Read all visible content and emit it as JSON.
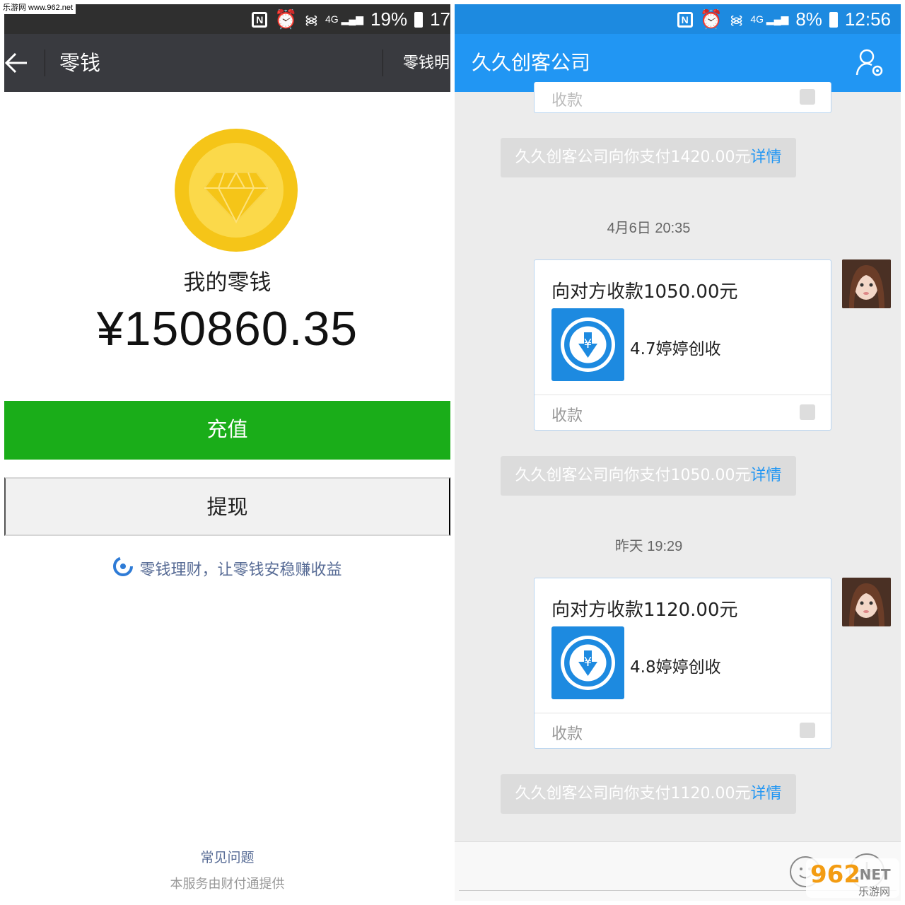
{
  "watermark": {
    "site": "乐游网 www.962.net",
    "logo_main": "962",
    "logo_tld": ".NET",
    "logo_sub": "乐游网"
  },
  "left": {
    "status": {
      "battery": "19%",
      "time": "17"
    },
    "nav": {
      "title": "零钱",
      "right_link": "零钱明"
    },
    "label": "我的零钱",
    "balance": "¥150860.35",
    "recharge_label": "充值",
    "withdraw_label": "提现",
    "finance_link": "零钱理财，让零钱安稳赚收益",
    "faq": "常见问题",
    "provider": "本服务由财付通提供"
  },
  "right": {
    "status": {
      "battery": "8%",
      "time": "12:56"
    },
    "nav": {
      "title": "久久创客公司"
    },
    "partial_card_footer": "收款",
    "notices": [
      {
        "text": "久久创客公司向你支付1420.00元",
        "link": "详情"
      },
      {
        "text": "久久创客公司向你支付1050.00元",
        "link": "详情"
      },
      {
        "text": "久久创客公司向你支付1120.00元",
        "link": "详情"
      }
    ],
    "timestamps": [
      "4月6日 20:35",
      "昨天 19:29"
    ],
    "cards": [
      {
        "title": "向对方收款1050.00元",
        "subtitle": "4.7婷婷创收",
        "footer": "收款"
      },
      {
        "title": "向对方收款1120.00元",
        "subtitle": "4.8婷婷创收",
        "footer": "收款"
      }
    ]
  },
  "colors": {
    "wechat_green": "#1aad19",
    "qq_blue": "#2196f3",
    "link_blue": "#576b95",
    "coin_yellow": "#f5c518"
  }
}
